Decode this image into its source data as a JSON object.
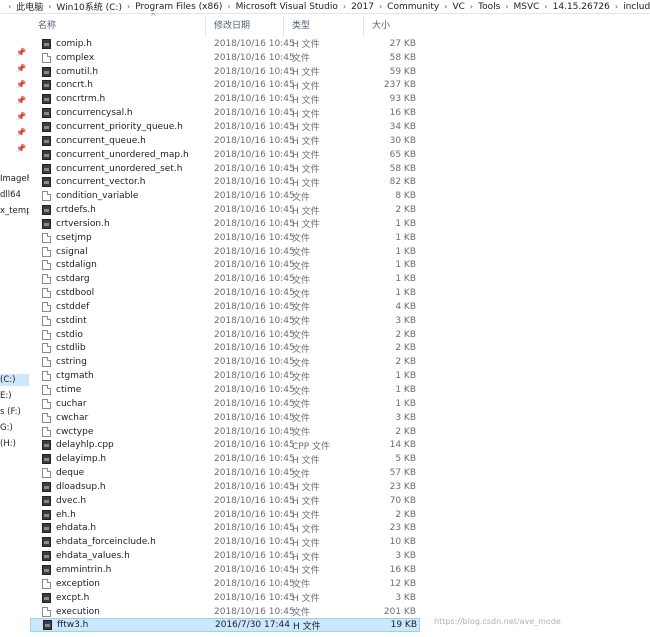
{
  "breadcrumb": [
    "此电脑",
    "Win10系统 (C:)",
    "Program Files (x86)",
    "Microsoft Visual Studio",
    "2017",
    "Community",
    "VC",
    "Tools",
    "MSVC",
    "14.15.26726",
    "include"
  ],
  "nav": {
    "items": [
      "ImageF",
      "dll64",
      "x_templ",
      "(C:)",
      "E:)",
      "s (F:)",
      "G:)",
      "(H:)"
    ]
  },
  "header": {
    "name": "名称",
    "date": "修改日期",
    "type": "类型",
    "size": "大小"
  },
  "files": [
    {
      "name": "comip.h",
      "date": "2018/10/16 10:45",
      "type": "H 文件",
      "size": "27 KB",
      "icon": "h"
    },
    {
      "name": "complex",
      "date": "2018/10/16 10:45",
      "type": "文件",
      "size": "58 KB",
      "icon": "plain"
    },
    {
      "name": "comutil.h",
      "date": "2018/10/16 10:45",
      "type": "H 文件",
      "size": "59 KB",
      "icon": "h"
    },
    {
      "name": "concrt.h",
      "date": "2018/10/16 10:45",
      "type": "H 文件",
      "size": "237 KB",
      "icon": "h"
    },
    {
      "name": "concrtrm.h",
      "date": "2018/10/16 10:45",
      "type": "H 文件",
      "size": "93 KB",
      "icon": "h"
    },
    {
      "name": "concurrencysal.h",
      "date": "2018/10/16 10:45",
      "type": "H 文件",
      "size": "16 KB",
      "icon": "h"
    },
    {
      "name": "concurrent_priority_queue.h",
      "date": "2018/10/16 10:45",
      "type": "H 文件",
      "size": "34 KB",
      "icon": "h"
    },
    {
      "name": "concurrent_queue.h",
      "date": "2018/10/16 10:45",
      "type": "H 文件",
      "size": "30 KB",
      "icon": "h"
    },
    {
      "name": "concurrent_unordered_map.h",
      "date": "2018/10/16 10:45",
      "type": "H 文件",
      "size": "65 KB",
      "icon": "h"
    },
    {
      "name": "concurrent_unordered_set.h",
      "date": "2018/10/16 10:45",
      "type": "H 文件",
      "size": "58 KB",
      "icon": "h"
    },
    {
      "name": "concurrent_vector.h",
      "date": "2018/10/16 10:45",
      "type": "H 文件",
      "size": "82 KB",
      "icon": "h"
    },
    {
      "name": "condition_variable",
      "date": "2018/10/16 10:45",
      "type": "文件",
      "size": "8 KB",
      "icon": "plain"
    },
    {
      "name": "crtdefs.h",
      "date": "2018/10/16 10:45",
      "type": "H 文件",
      "size": "2 KB",
      "icon": "h"
    },
    {
      "name": "crtversion.h",
      "date": "2018/10/16 10:45",
      "type": "H 文件",
      "size": "1 KB",
      "icon": "h"
    },
    {
      "name": "csetjmp",
      "date": "2018/10/16 10:45",
      "type": "文件",
      "size": "1 KB",
      "icon": "plain"
    },
    {
      "name": "csignal",
      "date": "2018/10/16 10:45",
      "type": "文件",
      "size": "1 KB",
      "icon": "plain"
    },
    {
      "name": "cstdalign",
      "date": "2018/10/16 10:45",
      "type": "文件",
      "size": "1 KB",
      "icon": "plain"
    },
    {
      "name": "cstdarg",
      "date": "2018/10/16 10:45",
      "type": "文件",
      "size": "1 KB",
      "icon": "plain"
    },
    {
      "name": "cstdbool",
      "date": "2018/10/16 10:45",
      "type": "文件",
      "size": "1 KB",
      "icon": "plain"
    },
    {
      "name": "cstddef",
      "date": "2018/10/16 10:45",
      "type": "文件",
      "size": "4 KB",
      "icon": "plain"
    },
    {
      "name": "cstdint",
      "date": "2018/10/16 10:45",
      "type": "文件",
      "size": "3 KB",
      "icon": "plain"
    },
    {
      "name": "cstdio",
      "date": "2018/10/16 10:45",
      "type": "文件",
      "size": "2 KB",
      "icon": "plain"
    },
    {
      "name": "cstdlib",
      "date": "2018/10/16 10:45",
      "type": "文件",
      "size": "2 KB",
      "icon": "plain"
    },
    {
      "name": "cstring",
      "date": "2018/10/16 10:45",
      "type": "文件",
      "size": "2 KB",
      "icon": "plain"
    },
    {
      "name": "ctgmath",
      "date": "2018/10/16 10:45",
      "type": "文件",
      "size": "1 KB",
      "icon": "plain"
    },
    {
      "name": "ctime",
      "date": "2018/10/16 10:45",
      "type": "文件",
      "size": "1 KB",
      "icon": "plain"
    },
    {
      "name": "cuchar",
      "date": "2018/10/16 10:45",
      "type": "文件",
      "size": "1 KB",
      "icon": "plain"
    },
    {
      "name": "cwchar",
      "date": "2018/10/16 10:45",
      "type": "文件",
      "size": "3 KB",
      "icon": "plain"
    },
    {
      "name": "cwctype",
      "date": "2018/10/16 10:45",
      "type": "文件",
      "size": "2 KB",
      "icon": "plain"
    },
    {
      "name": "delayhlp.cpp",
      "date": "2018/10/16 10:45",
      "type": "CPP 文件",
      "size": "14 KB",
      "icon": "cpp"
    },
    {
      "name": "delayimp.h",
      "date": "2018/10/16 10:45",
      "type": "H 文件",
      "size": "5 KB",
      "icon": "h"
    },
    {
      "name": "deque",
      "date": "2018/10/16 10:45",
      "type": "文件",
      "size": "57 KB",
      "icon": "plain"
    },
    {
      "name": "dloadsup.h",
      "date": "2018/10/16 10:45",
      "type": "H 文件",
      "size": "23 KB",
      "icon": "h"
    },
    {
      "name": "dvec.h",
      "date": "2018/10/16 10:45",
      "type": "H 文件",
      "size": "70 KB",
      "icon": "h"
    },
    {
      "name": "eh.h",
      "date": "2018/10/16 10:45",
      "type": "H 文件",
      "size": "2 KB",
      "icon": "h"
    },
    {
      "name": "ehdata.h",
      "date": "2018/10/16 10:45",
      "type": "H 文件",
      "size": "23 KB",
      "icon": "h"
    },
    {
      "name": "ehdata_forceinclude.h",
      "date": "2018/10/16 10:45",
      "type": "H 文件",
      "size": "10 KB",
      "icon": "h"
    },
    {
      "name": "ehdata_values.h",
      "date": "2018/10/16 10:45",
      "type": "H 文件",
      "size": "3 KB",
      "icon": "h"
    },
    {
      "name": "emmintrin.h",
      "date": "2018/10/16 10:45",
      "type": "H 文件",
      "size": "16 KB",
      "icon": "h"
    },
    {
      "name": "exception",
      "date": "2018/10/16 10:45",
      "type": "文件",
      "size": "12 KB",
      "icon": "plain"
    },
    {
      "name": "excpt.h",
      "date": "2018/10/16 10:45",
      "type": "H 文件",
      "size": "3 KB",
      "icon": "h"
    },
    {
      "name": "execution",
      "date": "2018/10/16 10:45",
      "type": "文件",
      "size": "201 KB",
      "icon": "plain"
    },
    {
      "name": "fftw3.h",
      "date": "2016/7/30 17:44",
      "type": "H 文件",
      "size": "19 KB",
      "icon": "h",
      "selected": true
    }
  ],
  "watermark": "https://blog.csdn.net/ave_mode"
}
